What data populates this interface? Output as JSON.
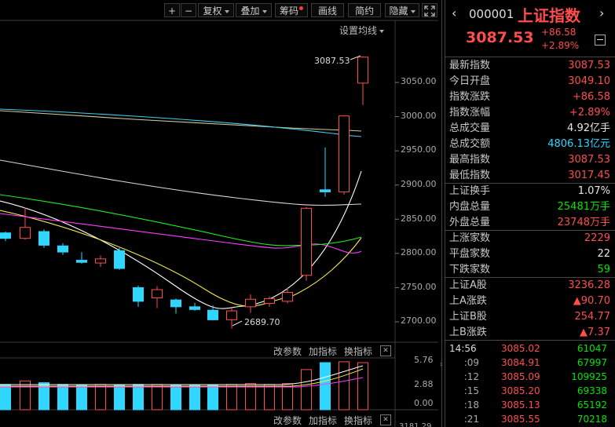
{
  "toolbar": {
    "plus": "+",
    "minus": "−",
    "fuquan": "复权",
    "diejia": "叠加",
    "chouma": "筹码",
    "huaxian": "画线",
    "jianyue": "简约",
    "yincang": "隐藏"
  },
  "chart": {
    "ma_settings": "设置均线",
    "y_ticks": [
      "3050.00",
      "3000.00",
      "2950.00",
      "2900.00",
      "2850.00",
      "2800.00",
      "2750.00",
      "2700.00"
    ],
    "high_label": "3087.53",
    "low_label": "2689.70",
    "vol_ticks": [
      "5.76",
      "2.88",
      "0.00"
    ],
    "vol_partial_tick": "3181.29"
  },
  "indicator_bar": {
    "gaicanshu": "改参数",
    "jiazhibiao": "加指标",
    "huanzhibiao": "换指标",
    "close": "✕"
  },
  "header": {
    "code": "000001",
    "name": "上证指数",
    "price": "3087.53",
    "change": "+86.58",
    "change_pct": "+2.89%"
  },
  "stats": [
    {
      "label": "最新指数",
      "value": "3087.53",
      "color": "red"
    },
    {
      "label": "今日开盘",
      "value": "3049.10",
      "color": "red"
    },
    {
      "label": "指数涨跌",
      "value": "+86.58",
      "color": "red"
    },
    {
      "label": "指数涨幅",
      "value": "+2.89%",
      "color": "red"
    },
    {
      "label": "总成交量",
      "value": "4.92亿手",
      "color": "white"
    },
    {
      "label": "总成交额",
      "value": "4806.13亿元",
      "color": "cyan"
    },
    {
      "label": "最高指数",
      "value": "3087.53",
      "color": "red"
    },
    {
      "label": "最低指数",
      "value": "3017.45",
      "color": "red"
    },
    {
      "label": "上证换手",
      "value": "1.07%",
      "color": "white"
    },
    {
      "label": "内盘总量",
      "value": "25481万手",
      "color": "green"
    },
    {
      "label": "外盘总量",
      "value": "23748万手",
      "color": "red"
    },
    {
      "label": "上涨家数",
      "value": "2229",
      "color": "red"
    },
    {
      "label": "平盘家数",
      "value": "22",
      "color": "white"
    },
    {
      "label": "下跌家数",
      "value": "59",
      "color": "green"
    },
    {
      "label": "上证A股",
      "value": "3236.28",
      "color": "red"
    },
    {
      "label": "上A涨跌",
      "value": "▲90.70",
      "color": "red"
    },
    {
      "label": "上证B股",
      "value": "254.77",
      "color": "red"
    },
    {
      "label": "上B涨跌",
      "value": "▲7.37",
      "color": "red"
    }
  ],
  "ticks": [
    {
      "time": "14:56",
      "price": "3085.02",
      "vol": "61047"
    },
    {
      "time": ":09",
      "price": "3084.91",
      "vol": "67997"
    },
    {
      "time": ":12",
      "price": "3085.09",
      "vol": "109925"
    },
    {
      "time": ":15",
      "price": "3085.20",
      "vol": "69338"
    },
    {
      "time": ":18",
      "price": "3085.13",
      "vol": "65192"
    },
    {
      "time": ":21",
      "price": "3085.55",
      "vol": "70218"
    }
  ],
  "candles": [
    {
      "o": 2830,
      "c": 2822,
      "h": 2832,
      "l": 2818,
      "color": "#2fd6ff"
    },
    {
      "o": 2822,
      "c": 2838,
      "h": 2867,
      "l": 2820,
      "color": "#ff4d4d"
    },
    {
      "o": 2832,
      "c": 2812,
      "h": 2835,
      "l": 2808,
      "color": "#2fd6ff"
    },
    {
      "o": 2811,
      "c": 2802,
      "h": 2815,
      "l": 2798,
      "color": "#2fd6ff"
    },
    {
      "o": 2790,
      "c": 2787,
      "h": 2802,
      "l": 2785,
      "color": "#2fd6ff"
    },
    {
      "o": 2786,
      "c": 2792,
      "h": 2797,
      "l": 2780,
      "color": "#ff4d4d"
    },
    {
      "o": 2804,
      "c": 2778,
      "h": 2808,
      "l": 2776,
      "color": "#2fd6ff"
    },
    {
      "o": 2750,
      "c": 2730,
      "h": 2753,
      "l": 2722,
      "color": "#2fd6ff"
    },
    {
      "o": 2735,
      "c": 2747,
      "h": 2752,
      "l": 2720,
      "color": "#ff4d4d"
    },
    {
      "o": 2732,
      "c": 2722,
      "h": 2734,
      "l": 2712,
      "color": "#2fd6ff"
    },
    {
      "o": 2722,
      "c": 2718,
      "h": 2728,
      "l": 2716,
      "color": "#2fd6ff"
    },
    {
      "o": 2717,
      "c": 2703,
      "h": 2724,
      "l": 2702,
      "color": "#2fd6ff"
    },
    {
      "o": 2703,
      "c": 2716,
      "h": 2721,
      "l": 2690,
      "color": "#ff4d4d"
    },
    {
      "o": 2722,
      "c": 2733,
      "h": 2740,
      "l": 2713,
      "color": "#ff4d4d"
    },
    {
      "o": 2727,
      "c": 2734,
      "h": 2737,
      "l": 2722,
      "color": "#ff4d4d"
    },
    {
      "o": 2730,
      "c": 2743,
      "h": 2750,
      "l": 2727,
      "color": "#ff4d4d"
    },
    {
      "o": 2768,
      "c": 2866,
      "h": 2868,
      "l": 2760,
      "color": "#ff4d4d"
    },
    {
      "o": 2893,
      "c": 2890,
      "h": 2955,
      "l": 2883,
      "color": "#2fd6ff"
    },
    {
      "o": 2890,
      "c": 3001,
      "h": 3002,
      "l": 2886,
      "color": "#ff4d4d"
    },
    {
      "o": 3049,
      "c": 3087,
      "h": 3088,
      "l": 3017,
      "color": "#ff4d4d"
    }
  ],
  "volumes": [
    {
      "v": 2.9,
      "color": "#2fd6ff"
    },
    {
      "v": 3.3,
      "color": "#ff4d4d"
    },
    {
      "v": 3.1,
      "color": "#2fd6ff"
    },
    {
      "v": 2.9,
      "color": "#2fd6ff"
    },
    {
      "v": 2.8,
      "color": "#2fd6ff"
    },
    {
      "v": 2.9,
      "color": "#ff4d4d"
    },
    {
      "v": 2.8,
      "color": "#2fd6ff"
    },
    {
      "v": 2.9,
      "color": "#2fd6ff"
    },
    {
      "v": 2.9,
      "color": "#ff4d4d"
    },
    {
      "v": 2.8,
      "color": "#2fd6ff"
    },
    {
      "v": 2.8,
      "color": "#2fd6ff"
    },
    {
      "v": 2.8,
      "color": "#2fd6ff"
    },
    {
      "v": 2.9,
      "color": "#ff4d4d"
    },
    {
      "v": 3.0,
      "color": "#ff4d4d"
    },
    {
      "v": 2.9,
      "color": "#ff4d4d"
    },
    {
      "v": 3.0,
      "color": "#ff4d4d"
    },
    {
      "v": 4.6,
      "color": "#ff4d4d"
    },
    {
      "v": 5.4,
      "color": "#2fd6ff"
    },
    {
      "v": 5.5,
      "color": "#ff4d4d"
    },
    {
      "v": 5.4,
      "color": "#ff4d4d"
    }
  ]
}
